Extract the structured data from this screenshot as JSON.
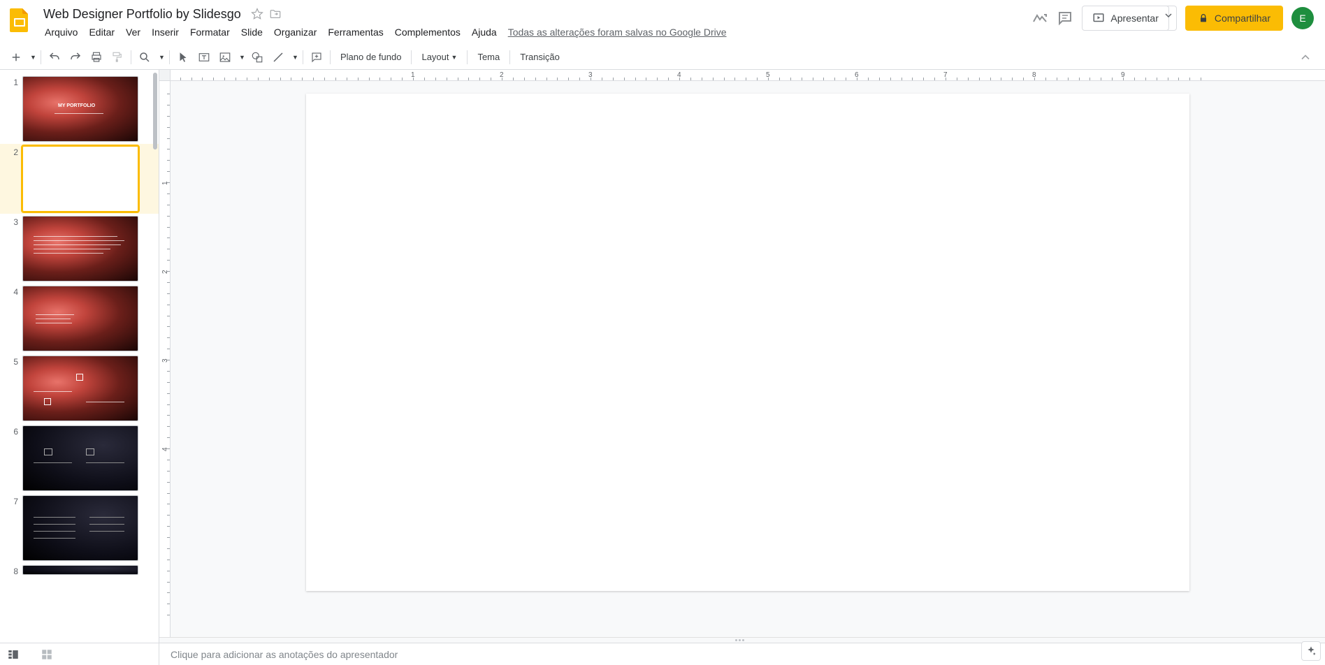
{
  "header": {
    "title": "Web Designer Portfolio by Slidesgo",
    "menus": [
      "Arquivo",
      "Editar",
      "Ver",
      "Inserir",
      "Formatar",
      "Slide",
      "Organizar",
      "Ferramentas",
      "Complementos",
      "Ajuda"
    ],
    "save_status": "Todas as alterações foram salvas no Google Drive",
    "present_label": "Apresentar",
    "share_label": "Compartilhar",
    "avatar_letter": "E"
  },
  "toolbar": {
    "background_label": "Plano de fundo",
    "layout_label": "Layout",
    "theme_label": "Tema",
    "transition_label": "Transição"
  },
  "ruler_marks": [
    "1",
    "2",
    "3",
    "4",
    "5",
    "6",
    "7",
    "8",
    "9"
  ],
  "v_ruler_marks": [
    "1",
    "2",
    "3",
    "4"
  ],
  "slides": [
    {
      "num": "1",
      "type": "red",
      "title": "MY PORTFOLIO"
    },
    {
      "num": "2",
      "type": "blank",
      "selected": true
    },
    {
      "num": "3",
      "type": "red"
    },
    {
      "num": "4",
      "type": "red"
    },
    {
      "num": "5",
      "type": "red"
    },
    {
      "num": "6",
      "type": "dark"
    },
    {
      "num": "7",
      "type": "dark"
    },
    {
      "num": "8",
      "type": "dark"
    }
  ],
  "notes": {
    "placeholder": "Clique para adicionar as anotações do apresentador"
  },
  "colors": {
    "accent": "#fbbc04",
    "avatar_bg": "#1e8e3e"
  }
}
